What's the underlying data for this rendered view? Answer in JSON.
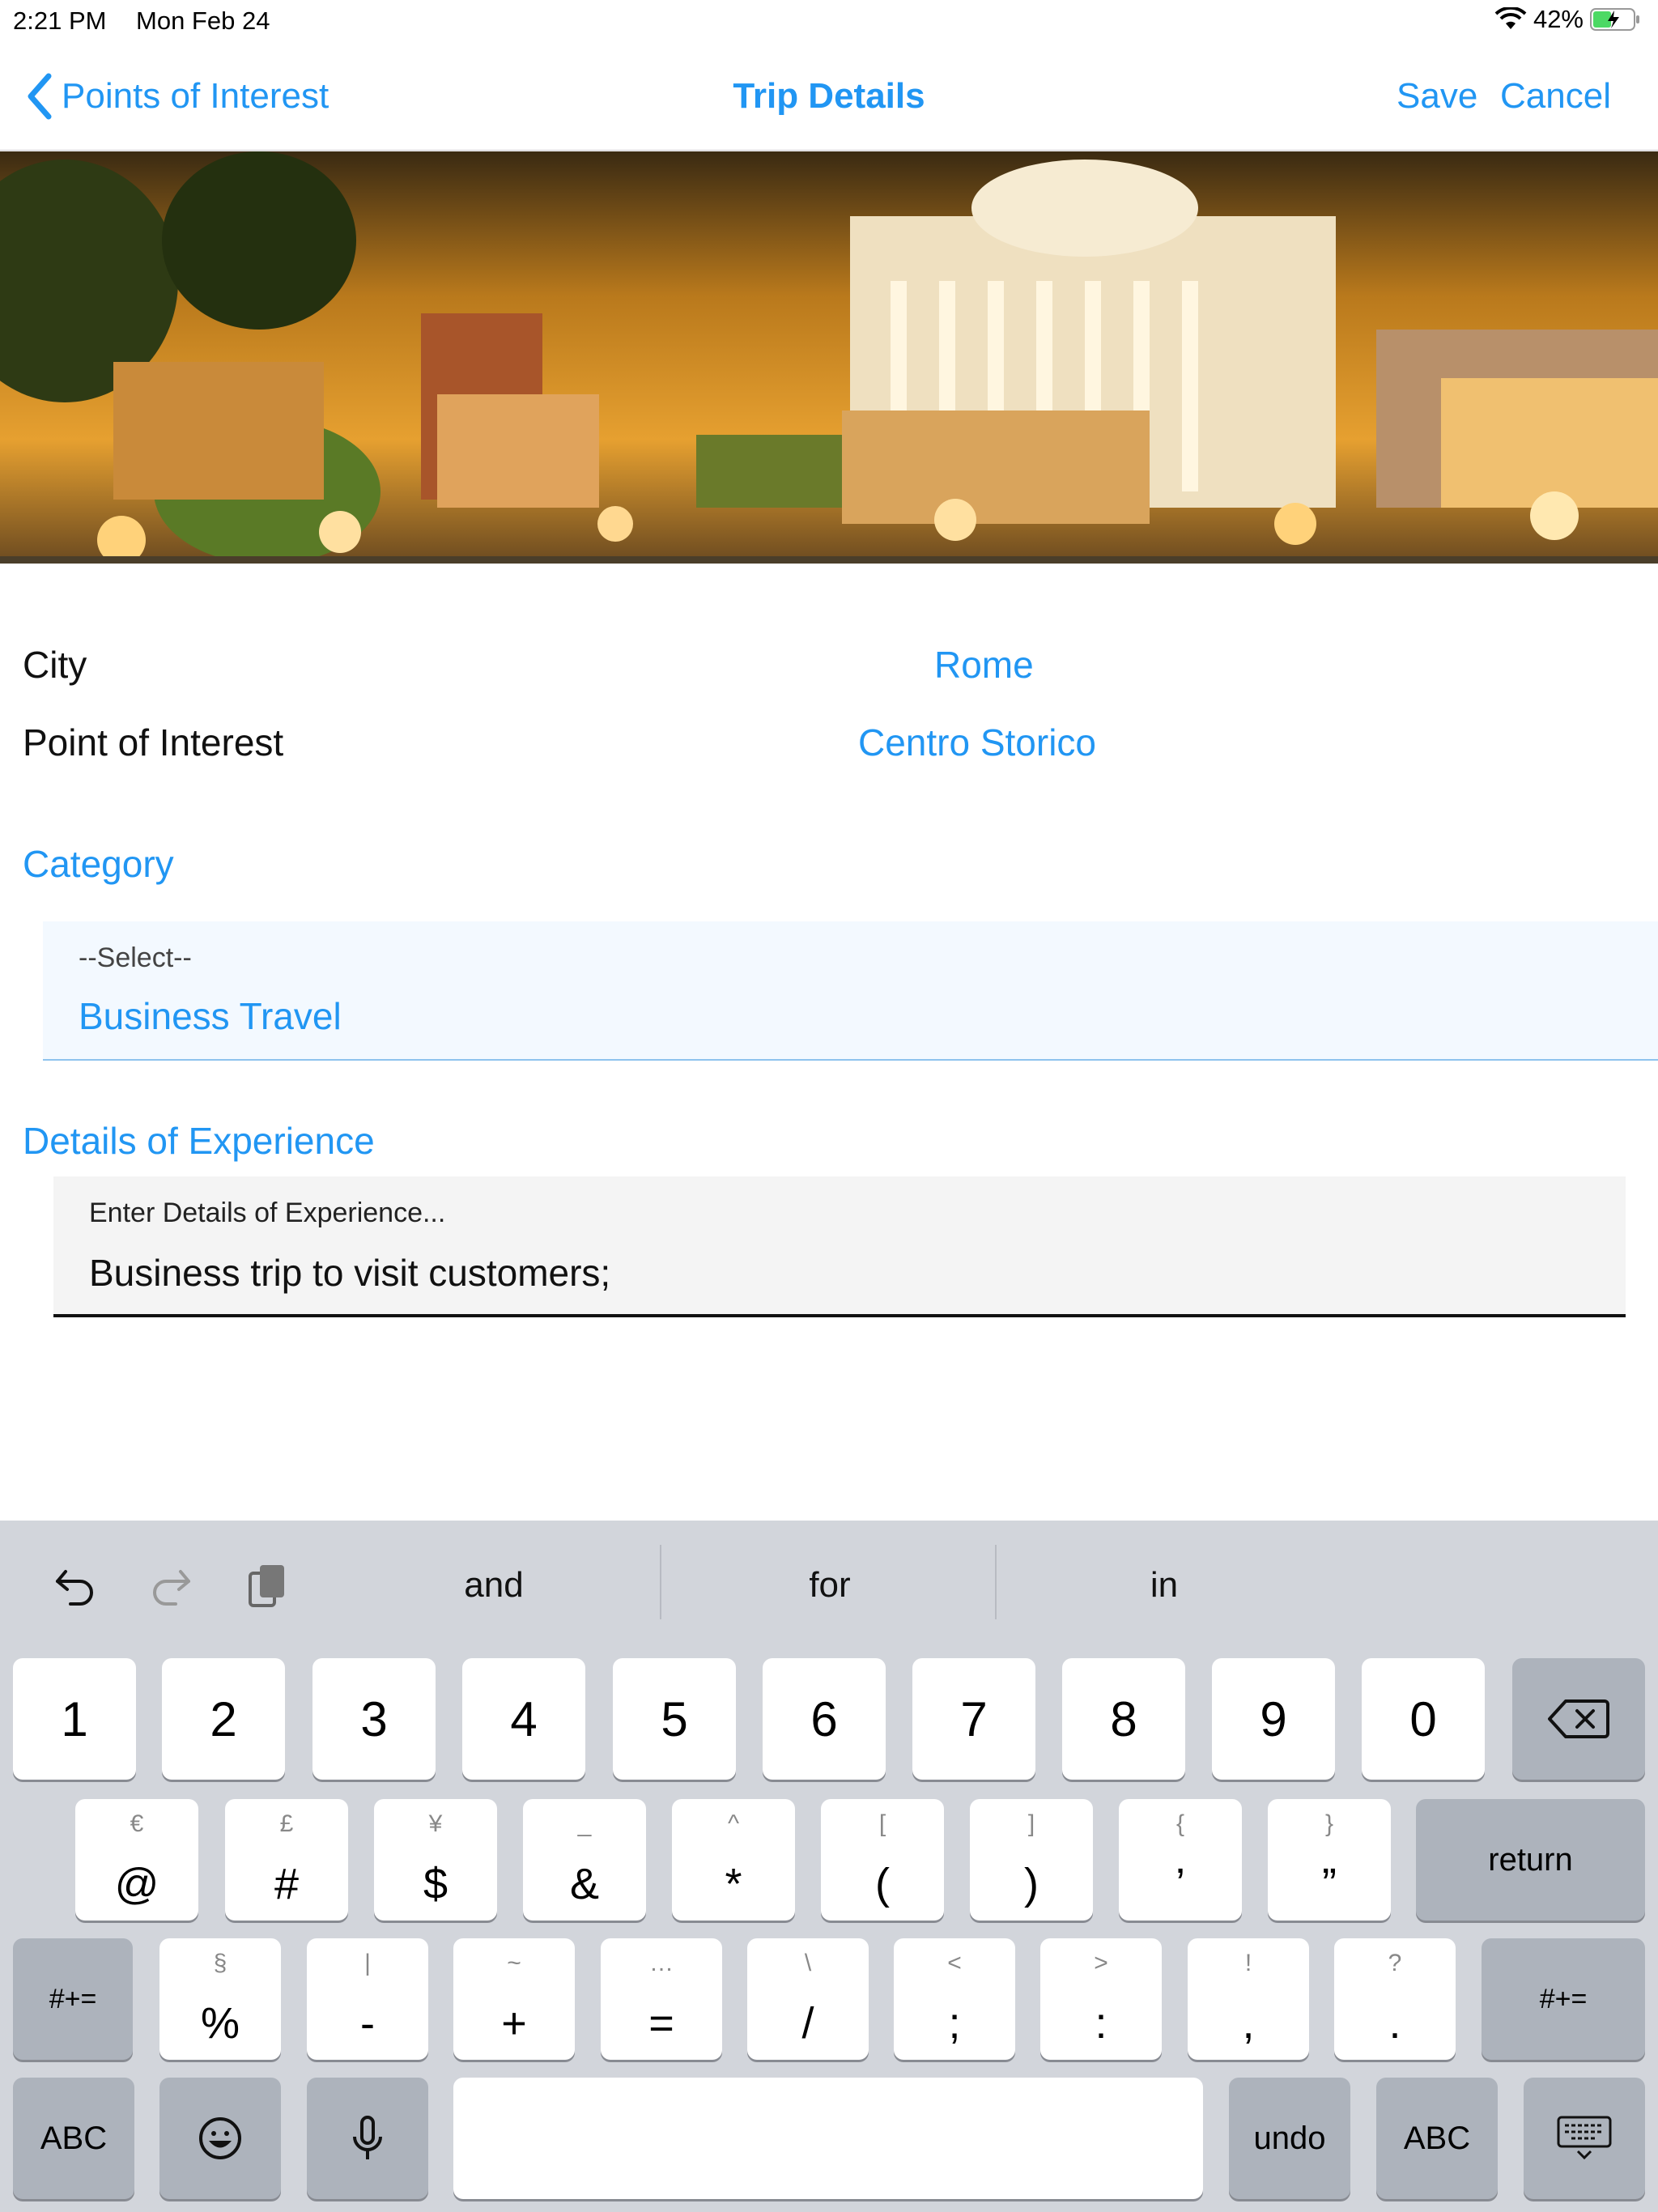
{
  "status": {
    "time": "2:21 PM",
    "date": "Mon Feb 24",
    "battery": "42%"
  },
  "nav": {
    "back_label": "Points of Interest",
    "title": "Trip Details",
    "save_label": "Save",
    "cancel_label": "Cancel"
  },
  "form": {
    "city_label": "City",
    "city_value": "Rome",
    "poi_label": "Point of Interest",
    "poi_value": "Centro Storico",
    "category_label": "Category",
    "category_placeholder": "--Select--",
    "category_value": "Business Travel",
    "details_label": "Details of Experience",
    "details_placeholder": "Enter Details of Experience...",
    "details_value": "Business trip to visit customers;"
  },
  "keyboard": {
    "suggestions": [
      "and",
      "for",
      "in"
    ],
    "row1": [
      "1",
      "2",
      "3",
      "4",
      "5",
      "6",
      "7",
      "8",
      "9",
      "0"
    ],
    "row2": [
      {
        "alt": "€",
        "main": "@"
      },
      {
        "alt": "£",
        "main": "#"
      },
      {
        "alt": "¥",
        "main": "$"
      },
      {
        "alt": "_",
        "main": "&"
      },
      {
        "alt": "^",
        "main": "*"
      },
      {
        "alt": "[",
        "main": "("
      },
      {
        "alt": "]",
        "main": ")"
      },
      {
        "alt": "{",
        "main": "’"
      },
      {
        "alt": "}",
        "main": "”"
      }
    ],
    "return_label": "return",
    "row3": [
      {
        "alt": "§",
        "main": "%"
      },
      {
        "alt": "|",
        "main": "-"
      },
      {
        "alt": "~",
        "main": "+"
      },
      {
        "alt": "…",
        "main": "="
      },
      {
        "alt": "\\",
        "main": "/"
      },
      {
        "alt": "<",
        "main": ";"
      },
      {
        "alt": ">",
        "main": ":"
      },
      {
        "alt": "!",
        "main": ","
      },
      {
        "alt": "?",
        "main": "."
      }
    ],
    "symbols_label": "#+=",
    "abc_label": "ABC",
    "undo_label": "undo"
  },
  "colors": {
    "accent": "#2196f3",
    "keyboard_bg": "#d2d5db",
    "key": "#ffffff",
    "key_dark": "#adb3bc"
  }
}
